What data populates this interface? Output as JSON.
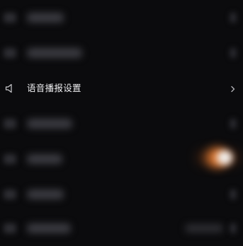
{
  "menu": {
    "active_item": {
      "label": "语音播报设置",
      "icon": "speaker-icon",
      "trailing_icon": "chevron-right-icon"
    },
    "blurred_items_count_above": 2,
    "blurred_items_count_below": 4
  },
  "colors": {
    "background": "#0b0b0d",
    "text": "#eeeef0",
    "icon": "#c9c9cc",
    "toggle_accent": "#e07a32"
  }
}
